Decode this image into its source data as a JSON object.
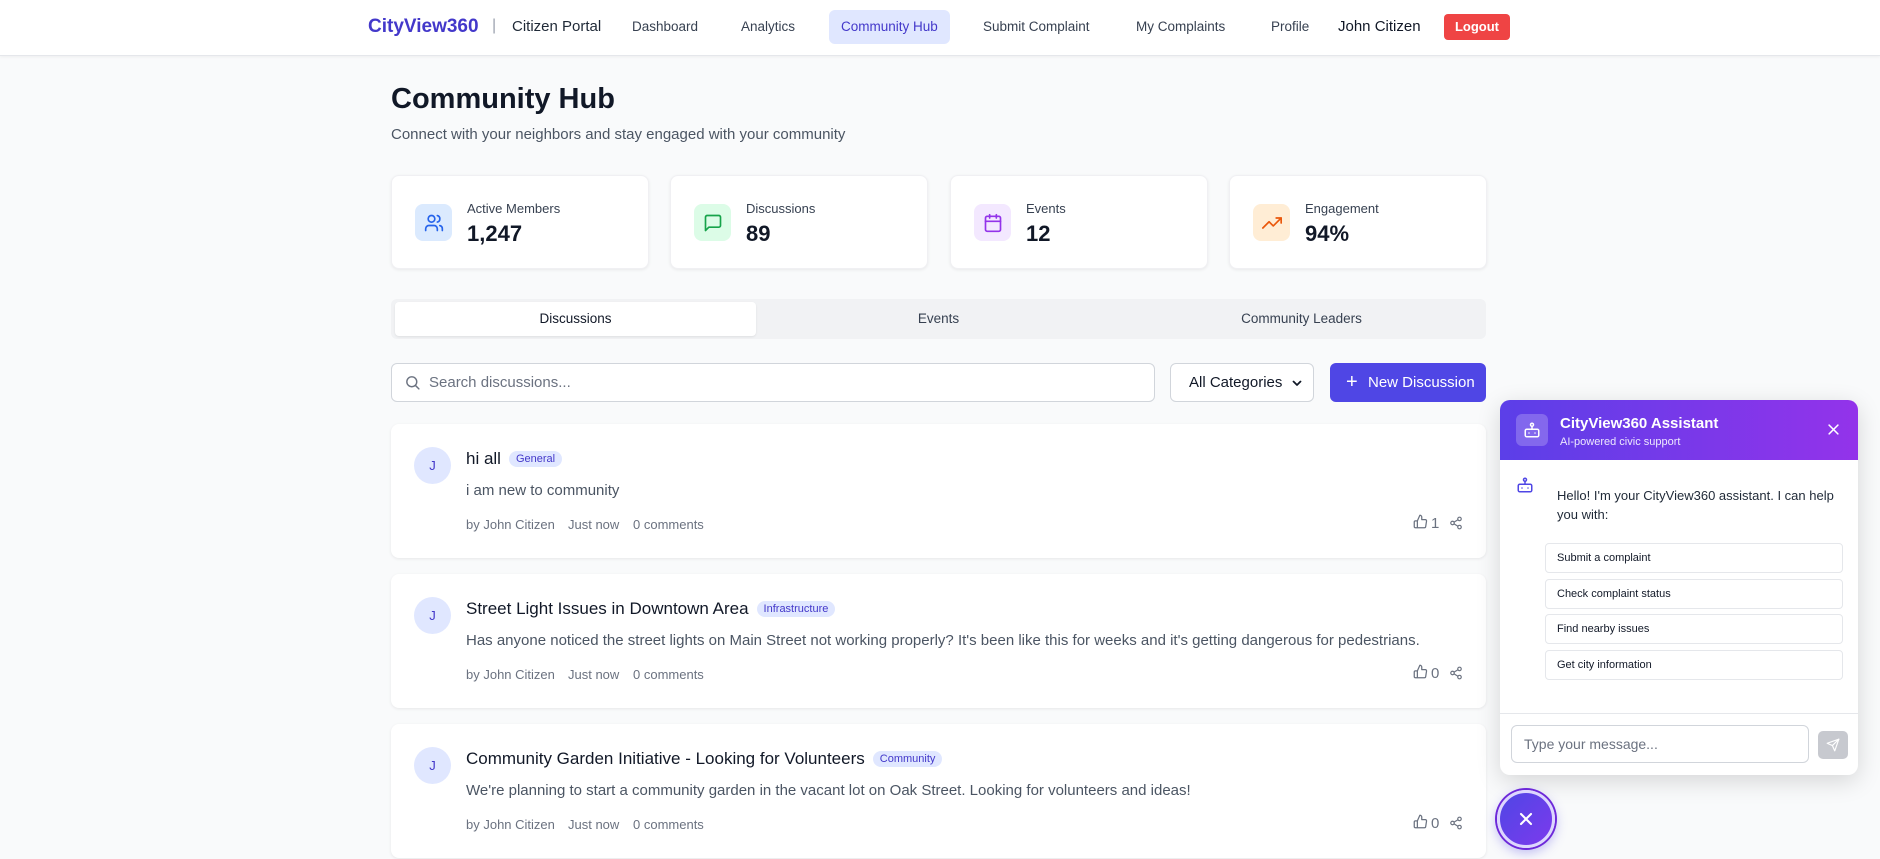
{
  "nav": {
    "brand": "CityView360",
    "separator": "|",
    "portal": "Citizen Portal",
    "links": [
      "Dashboard",
      "Analytics",
      "Community Hub",
      "Submit Complaint",
      "My Complaints",
      "Profile"
    ],
    "active_link": "Community Hub",
    "user": "John Citizen",
    "logout": "Logout"
  },
  "header": {
    "title": "Community Hub",
    "subtitle": "Connect with your neighbors and stay engaged with your community"
  },
  "stats": [
    {
      "label": "Active Members",
      "value": "1,247",
      "icon": "users-icon",
      "color": "#2563eb",
      "bg": "#dbeafe"
    },
    {
      "label": "Discussions",
      "value": "89",
      "icon": "message-square-icon",
      "color": "#16a34a",
      "bg": "#dcfce7"
    },
    {
      "label": "Events",
      "value": "12",
      "icon": "calendar-icon",
      "color": "#9333ea",
      "bg": "#f3e8ff"
    },
    {
      "label": "Engagement",
      "value": "94%",
      "icon": "trending-up-icon",
      "color": "#ea580c",
      "bg": "#ffedd5"
    }
  ],
  "tabs": [
    "Discussions",
    "Events",
    "Community Leaders"
  ],
  "active_tab": "Discussions",
  "toolbar": {
    "search_placeholder": "Search discussions...",
    "category": "All Categories",
    "new_button": "New Discussion",
    "plus": "+"
  },
  "posts": [
    {
      "avatar": "J",
      "title": "hi all",
      "category": "General",
      "body": "i am new to community",
      "author": "by John Citizen",
      "time": "Just now",
      "comments": "0 comments",
      "likes": "1"
    },
    {
      "avatar": "J",
      "title": "Street Light Issues in Downtown Area",
      "category": "Infrastructure",
      "body": "Has anyone noticed the street lights on Main Street not working properly? It's been like this for weeks and it's getting dangerous for pedestrians.",
      "author": "by John Citizen",
      "time": "Just now",
      "comments": "0 comments",
      "likes": "0"
    },
    {
      "avatar": "J",
      "title": "Community Garden Initiative - Looking for Volunteers",
      "category": "Community",
      "body": "We're planning to start a community garden in the vacant lot on Oak Street. Looking for volunteers and ideas!",
      "author": "by John Citizen",
      "time": "Just now",
      "comments": "0 comments",
      "likes": "0"
    }
  ],
  "chat": {
    "title": "CityView360 Assistant",
    "subtitle": "AI-powered civic support",
    "greeting": "Hello! I'm your CityView360 assistant. I can help you with:",
    "quick_actions": [
      "Submit a complaint",
      "Check complaint status",
      "Find nearby issues",
      "Get city information"
    ],
    "input_placeholder": "Type your message..."
  },
  "colors": {
    "accent": "#4f46e5",
    "brand": "#4338ca",
    "danger": "#ef4444"
  }
}
